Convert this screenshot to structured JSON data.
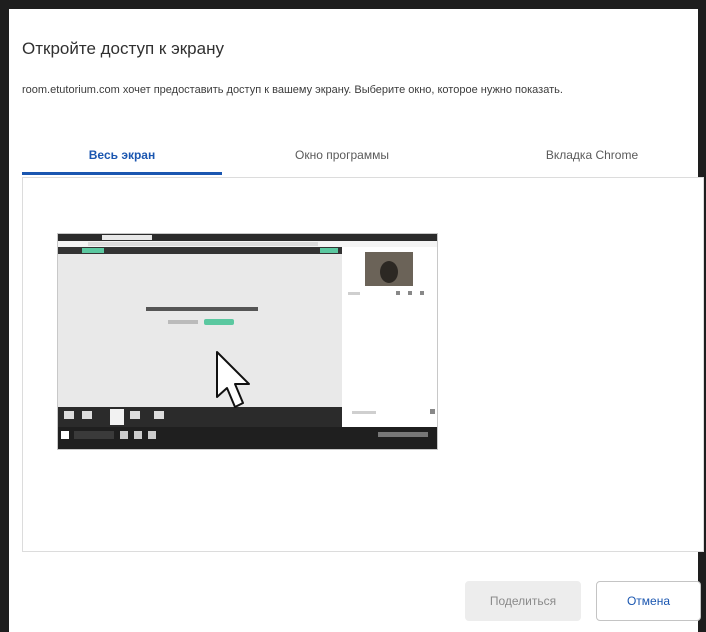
{
  "dialog": {
    "title": "Откройте доступ к экрану",
    "description": "room.etutorium.com хочет предоставить доступ к вашему экрану. Выберите окно, которое нужно показать.",
    "tabs": [
      {
        "label": "Весь экран",
        "active": true
      },
      {
        "label": "Окно программы",
        "active": false
      },
      {
        "label": "Вкладка Chrome",
        "active": false
      }
    ],
    "share_label": "Поделиться",
    "cancel_label": "Отмена"
  },
  "preview": {
    "icon": "cursor-arrow-icon",
    "description": "Whole-screen thumbnail of a conferencing web page"
  },
  "colors": {
    "accent": "#1a56b0",
    "panel_border": "#dcdcdc",
    "share_disabled_bg": "#ededed",
    "thumb_button": "#5bc8a0"
  }
}
